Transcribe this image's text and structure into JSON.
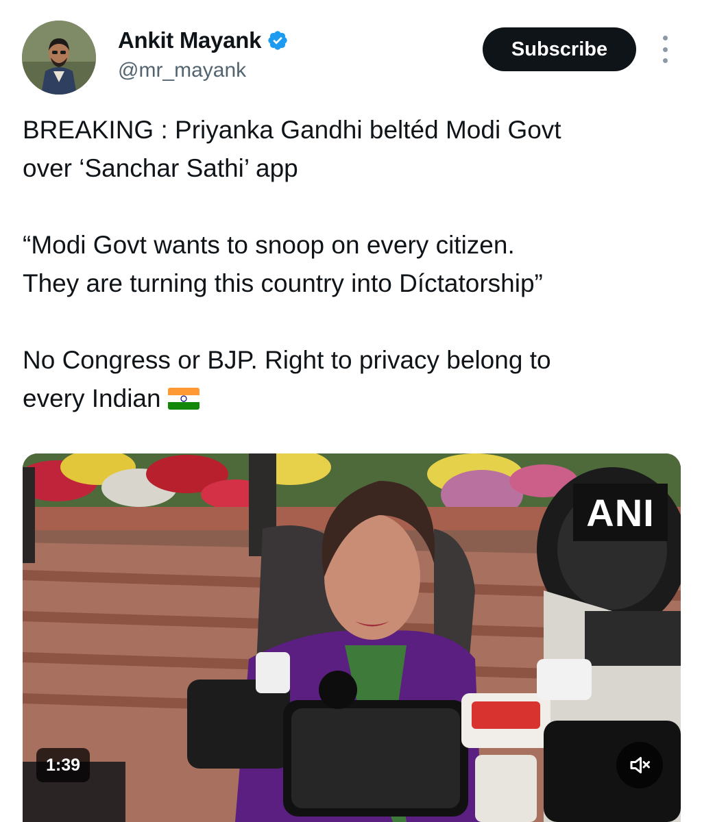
{
  "author": {
    "name": "Ankit Mayank",
    "handle": "@mr_mayank",
    "verified": true,
    "verified_color": "#1d9bf0"
  },
  "actions": {
    "subscribe_label": "Subscribe",
    "more_icon": "more-vertical-icon"
  },
  "tweet": {
    "paragraphs": [
      "BREAKING : Priyanka Gandhi beltéd Modi Govt\nover ‘Sanchar Sathi’ app",
      "“Modi Govt wants to snoop on every citizen.\nThey are turning this country into Díctatorship”",
      "No Congress or BJP. Right to privacy belong to\nevery Indian"
    ],
    "emoji": "india-flag"
  },
  "media": {
    "watermark": "ANI",
    "duration": "1:39",
    "mute_icon": "speaker-muted-icon"
  }
}
